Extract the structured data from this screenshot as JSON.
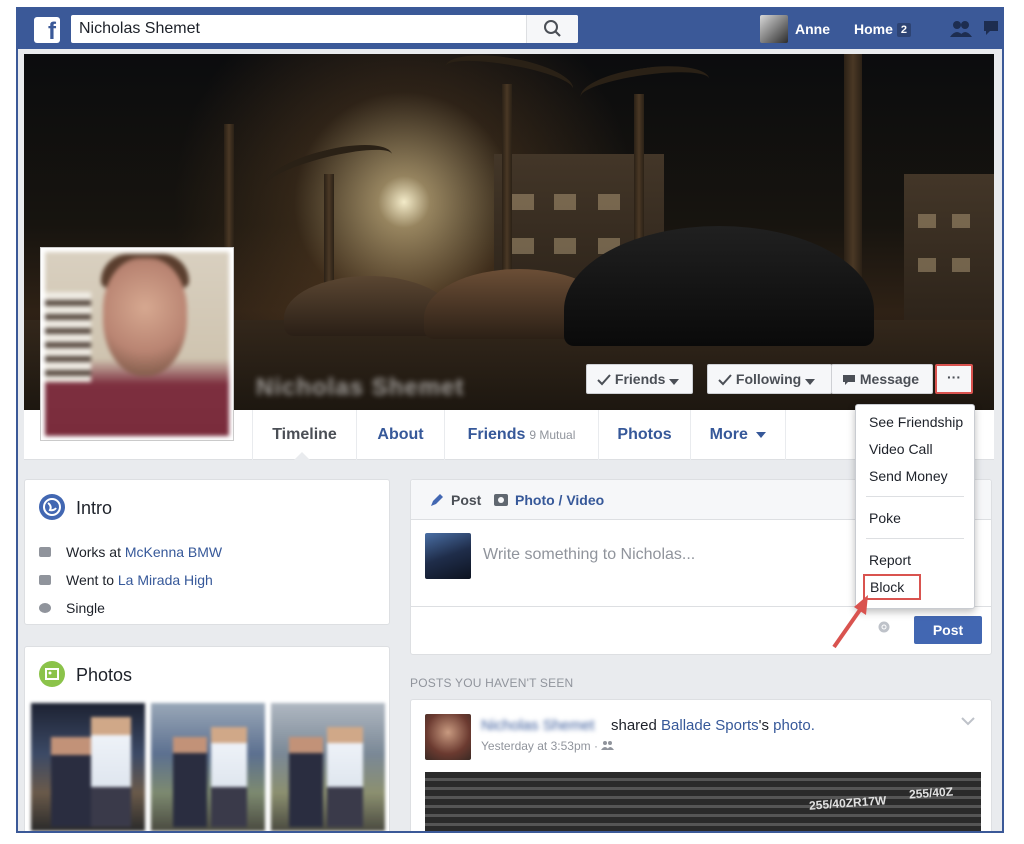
{
  "search": {
    "value": "Nicholas Shemet"
  },
  "topbar": {
    "user_name": "Anne",
    "home_label": "Home",
    "home_count": "2"
  },
  "cover": {
    "profile_name": "Nicholas Shemet"
  },
  "cover_buttons": {
    "friends": "Friends",
    "following": "Following",
    "message": "Message",
    "more": "···"
  },
  "profile_nav": {
    "timeline": "Timeline",
    "about": "About",
    "friends": "Friends",
    "friends_mutual": "9 Mutual",
    "photos": "Photos",
    "more": "More"
  },
  "options_menu": {
    "items": [
      "See Friendship",
      "Video Call",
      "Send Money",
      "Poke",
      "Report",
      "Block"
    ]
  },
  "intro": {
    "title": "Intro",
    "works_prefix": "Works at",
    "works_place": "McKenna BMW",
    "went_prefix": "Went to",
    "went_place": "La Mirada High",
    "status": "Single"
  },
  "photos_card": {
    "title": "Photos"
  },
  "composer": {
    "tab_post": "Post",
    "tab_photo": "Photo / Video",
    "placeholder": "Write something to Nicholas...",
    "post_button": "Post"
  },
  "feed": {
    "section_label": "POSTS YOU HAVEN'T SEEN",
    "author": "Nicholas Shemet",
    "shared": "shared",
    "page": "Ballade Sports",
    "possessive": "'s",
    "photo": "photo.",
    "time": "Yesterday at 3:53pm ·",
    "tire_text_1": "255/40ZR17W",
    "tire_text_2": "255/40Z"
  },
  "colors": {
    "brand": "#3b5998",
    "link": "#365899",
    "button": "#4267b2",
    "highlight": "#d9534f"
  }
}
